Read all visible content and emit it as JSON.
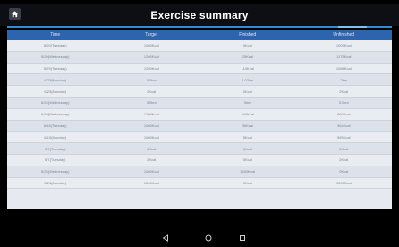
{
  "app_bar": {
    "title": "Exercise summary",
    "home_icon": "home-icon"
  },
  "colors": {
    "app_bar": "#0d0f14",
    "accent": "#2b8fd6",
    "table_header": "#2e63ad",
    "row_odd": "#e9ecf1",
    "row_even": "#dde2ea"
  },
  "table": {
    "headers": [
      "Time",
      "Target",
      "Finished",
      "Unfinished"
    ],
    "rows": [
      [
        "5/20(Tuesday)",
        "1000Kcal",
        "0Kcal",
        "1000Kcal"
      ],
      [
        "5/20(Wednesday)",
        "1200Kcal",
        "25Kcal",
        "1175Kcal"
      ],
      [
        "5/29(Tuesday)",
        "1200Kcal",
        "114Kcal",
        "1086Kcal"
      ],
      [
        "6/23(Monday)",
        "3.0km",
        "1.02km",
        "2km"
      ],
      [
        "6/23(Monday)",
        "2Kcal",
        "0Kcal",
        "2Kcal"
      ],
      [
        "6/24(Wednesday)",
        "3.0km",
        "0km",
        "3.0km"
      ],
      [
        "6/10(Wednesday)",
        "1200Kcal",
        "240Kcal",
        "960Kcal"
      ],
      [
        "6/16(Tuesday)",
        "1000Kcal",
        "36Kcal",
        "964Kcal"
      ],
      [
        "6/10(Monday)",
        "1000Kcal",
        "5Kcal",
        "995Kcal"
      ],
      [
        "6/7(Tuesday)",
        "2Kcal",
        "0Kcal",
        "2Kcal"
      ],
      [
        "6/7(Tuesday)",
        "2Kcal",
        "0Kcal",
        "2Kcal"
      ],
      [
        "5/25(Wednesday)",
        "1000Kcal",
        "1000Kcal",
        "0Kcal"
      ],
      [
        "5/24(Monday)",
        "1000Kcal",
        "0Kcal",
        "1000Kcal"
      ]
    ]
  },
  "nav": {
    "back_icon": "back-triangle-icon",
    "home_icon": "home-circle-icon",
    "recent_icon": "recent-square-icon"
  }
}
